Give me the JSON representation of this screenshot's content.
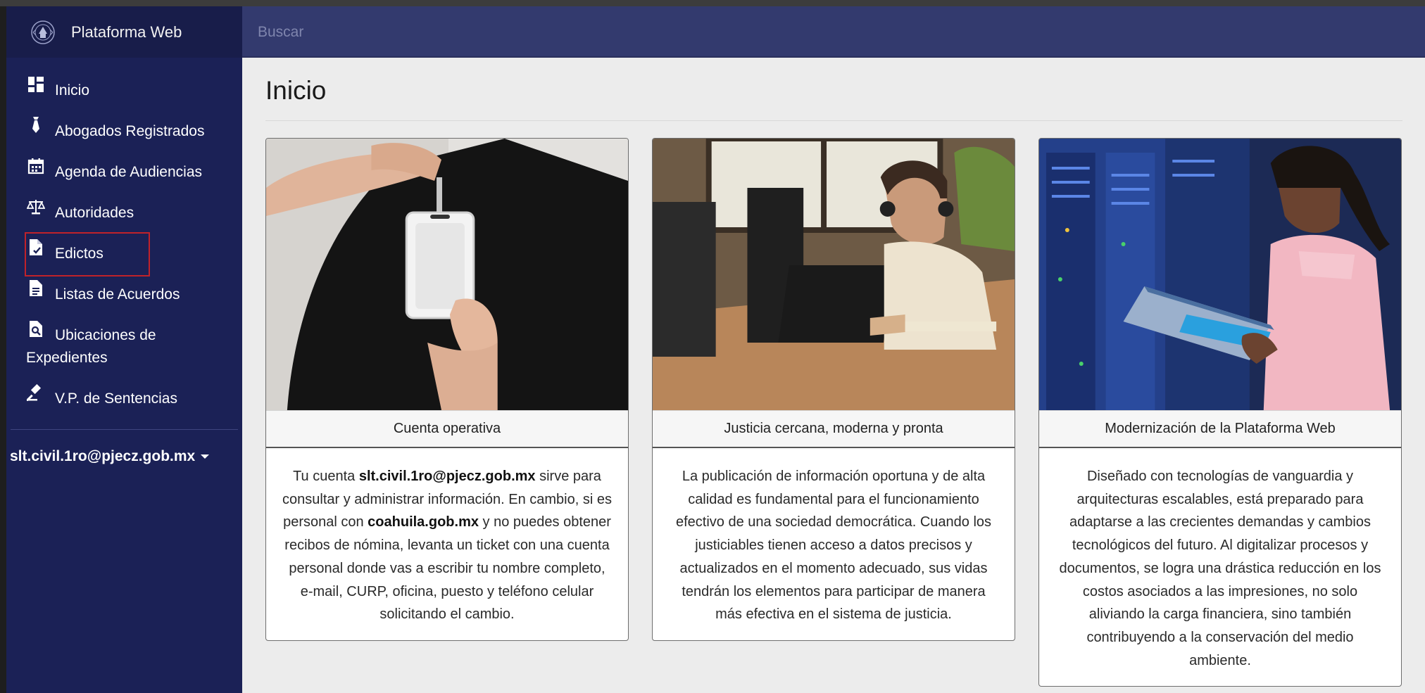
{
  "app": {
    "title": "Plataforma Web"
  },
  "search": {
    "placeholder": "Buscar"
  },
  "sidebar": {
    "items": [
      {
        "label": "Inicio",
        "icon": "dashboard-icon"
      },
      {
        "label": "Abogados Registrados",
        "icon": "tie-icon"
      },
      {
        "label": "Agenda de Audiencias",
        "icon": "calendar-icon"
      },
      {
        "label": "Autoridades",
        "icon": "scale-icon"
      },
      {
        "label": "Edictos",
        "icon": "document-check-icon"
      },
      {
        "label": "Listas de Acuerdos",
        "icon": "document-icon"
      },
      {
        "label": "Ubicaciones de",
        "label2": "Expedientes",
        "icon": "file-search-icon"
      },
      {
        "label": "V.P. de Sentencias",
        "icon": "gavel-icon"
      }
    ],
    "user": "slt.civil.1ro@pjecz.gob.mx"
  },
  "main": {
    "title": "Inicio",
    "cards": [
      {
        "header": "Cuenta operativa",
        "body": {
          "p1": "Tu cuenta ",
          "b1": "slt.civil.1ro@pjecz.gob.mx",
          "p2": " sirve para consultar y administrar información. En cambio, si es personal con ",
          "b2": "coahuila.gob.mx",
          "p3": " y no puedes obtener recibos de nómina, levanta un ticket con una cuenta personal donde vas a escribir tu nombre completo, e-mail, CURP, oficina, puesto y teléfono celular solicitando el cambio."
        }
      },
      {
        "header": "Justicia cercana, moderna y pronta",
        "body_text": "La publicación de información oportuna y de alta calidad es fundamental para el funcionamiento efectivo de una sociedad democrática. Cuando los justiciables tienen acceso a datos precisos y actualizados en el momento adecuado, sus vidas tendrán los elementos para participar de manera más efectiva en el sistema de justicia."
      },
      {
        "header": "Modernización de la Plataforma Web",
        "body_text": "Diseñado con tecnologías de vanguardia y arquitecturas escalables, está preparado para adaptarse a las crecientes demandas y cambios tecnológicos del futuro. Al digitalizar procesos y documentos, se logra una drástica reducción en los costos asociados a las impresiones, no solo aliviando la carga financiera, sino también contribuyendo a la conservación del medio ambiente."
      }
    ]
  },
  "colors": {
    "sidebar_bg": "#1b2156",
    "topbar_bg": "#333a6e",
    "highlight_border": "#c0222a"
  }
}
